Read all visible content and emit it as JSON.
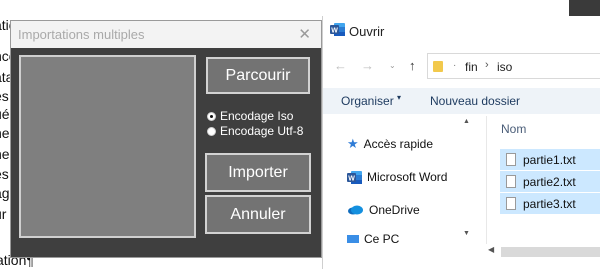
{
  "background_doc": {
    "line_fragments": [
      "ation",
      "nco",
      "ata",
      "es",
      "ué",
      "ne",
      "ne",
      "es",
      "ag",
      "ur"
    ],
    "bottom_line": "ation¶"
  },
  "import_dialog": {
    "title": "Importations multiples",
    "close_glyph": "✕",
    "browse_label": "Parcourir",
    "encoding_options": [
      {
        "label": "Encodage Iso",
        "selected": true
      },
      {
        "label": "Encodage Utf-8",
        "selected": false
      }
    ],
    "import_label": "Importer",
    "cancel_label": "Annuler"
  },
  "open_dialog": {
    "title": "Ouvrir",
    "nav": {
      "back": "←",
      "forward": "→",
      "dropdown": "⌄",
      "up": "↑"
    },
    "address": {
      "sep": "·",
      "crumbs": [
        "fin",
        "iso"
      ],
      "sep2": "›"
    },
    "command_bar": {
      "organize": "Organiser",
      "organize_caret": "▾",
      "new_folder": "Nouveau dossier"
    },
    "nav_items": [
      {
        "label": "Accès rapide",
        "icon": "star-icon"
      },
      {
        "label": "Microsoft Word",
        "icon": "word-icon"
      },
      {
        "label": "OneDrive",
        "icon": "cloud-icon"
      },
      {
        "label": "Ce PC",
        "icon": "pc-icon"
      }
    ],
    "column_header": "Nom",
    "files": [
      "partie1.txt",
      "partie2.txt",
      "partie3.txt"
    ],
    "scroll_glyphs": {
      "up": "▲",
      "down": "▼",
      "left": "◀"
    }
  },
  "colors": {
    "import_dialog_bg": "#3f3f3f",
    "button_bg": "#737373",
    "selection_bg": "#cce8ff",
    "command_bar_bg": "#eef3f8",
    "word_blue": "#2b579a"
  }
}
